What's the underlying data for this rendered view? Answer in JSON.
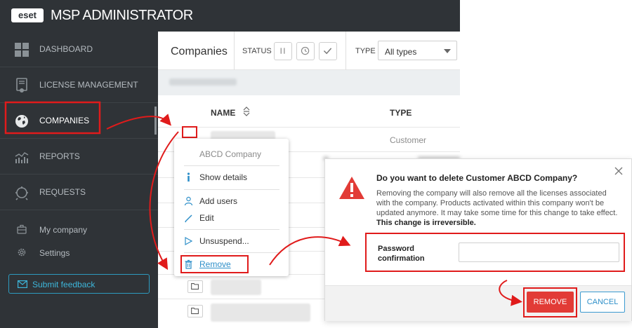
{
  "header": {
    "logo": "eset",
    "app_title": "MSP ADMINISTRATOR"
  },
  "sidebar": {
    "items": [
      {
        "label": "DASHBOARD",
        "icon": "dashboard-grid-icon"
      },
      {
        "label": "LICENSE MANAGEMENT",
        "icon": "license-document-icon"
      },
      {
        "label": "COMPANIES",
        "icon": "globe-icon",
        "active": true
      },
      {
        "label": "REPORTS",
        "icon": "bar-chart-icon"
      },
      {
        "label": "REQUESTS",
        "icon": "alarm-icon"
      }
    ],
    "sub_items": [
      {
        "label": "My company",
        "icon": "briefcase-icon"
      },
      {
        "label": "Settings",
        "icon": "gear-icon"
      }
    ],
    "feedback_label": "Submit feedback"
  },
  "main": {
    "title": "Companies",
    "status_label": "STATUS",
    "type_label": "TYPE",
    "type_value": "All types",
    "columns": {
      "name": "NAME",
      "type": "TYPE"
    },
    "first_row_type": "Customer"
  },
  "context_menu": {
    "title": "ABCD Company",
    "items": [
      {
        "label": "Show details",
        "icon": "info-icon"
      },
      {
        "label": "Add users",
        "icon": "user-icon"
      },
      {
        "label": "Edit",
        "icon": "pencil-icon"
      },
      {
        "label": "Unsuspend...",
        "icon": "play-icon"
      },
      {
        "label": "Remove",
        "icon": "trash-icon"
      }
    ]
  },
  "dialog": {
    "title": "Do you want to delete Customer ABCD Company?",
    "body": "Removing the company will also remove all the licenses associated with the company. Products activated within this company won't be updated anymore. It may take some time for this change to take effect.",
    "body_bold": "This change is irreversible.",
    "password_label": "Password confirmation",
    "password_value": "",
    "remove_label": "REMOVE",
    "cancel_label": "CANCEL"
  },
  "colors": {
    "sidebar_bg": "#2f3337",
    "highlight_red": "#e01b1b",
    "remove_button": "#e23b36",
    "link_blue": "#2e8fc9",
    "feedback_accent": "#3db6da"
  }
}
